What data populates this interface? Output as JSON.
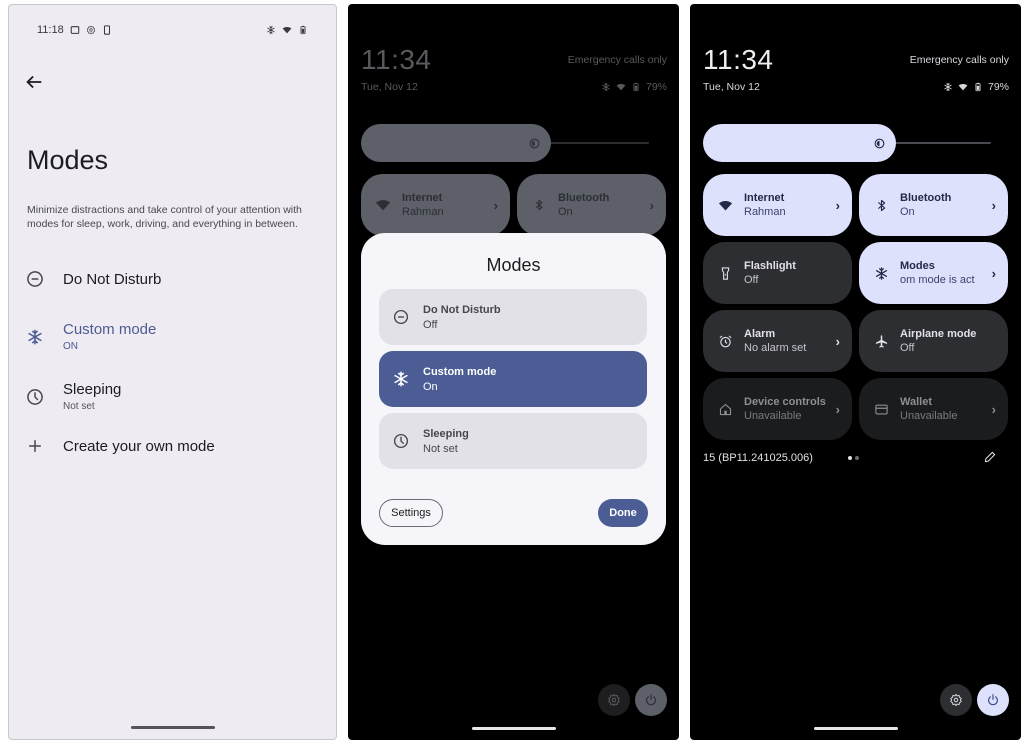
{
  "settings_screen": {
    "status_bar": {
      "time": "11:18",
      "left_icons": [
        "screen-icon",
        "settings-status-icon",
        "phone-status-icon"
      ],
      "right_icons": [
        "modes-status-icon",
        "wifi-icon",
        "battery-icon"
      ]
    },
    "back_icon": "arrow-left-icon",
    "title": "Modes",
    "description": "Minimize distractions and take control of your attention with modes for sleep, work, driving, and everything in between.",
    "modes": [
      {
        "icon": "do-not-disturb-icon",
        "name": "Do Not Disturb",
        "status": ""
      },
      {
        "icon": "snowflake-icon",
        "name": "Custom mode",
        "status": "ON",
        "active": true
      },
      {
        "icon": "clock-icon",
        "name": "Sleeping",
        "status": "Not set"
      },
      {
        "icon": "plus-icon",
        "name": "Create your own mode",
        "status": ""
      }
    ],
    "accent_color": "#4c5b91"
  },
  "shade_dialog": {
    "time": "11:34",
    "date": "Tue, Nov 12",
    "carrier": "Emergency calls only",
    "battery": "79%",
    "tiles": [
      {
        "icon": "wifi-icon",
        "name": "Internet",
        "status": "Rahman"
      },
      {
        "icon": "bluetooth-icon",
        "name": "Bluetooth",
        "status": "On"
      }
    ],
    "dialog": {
      "title": "Modes",
      "items": [
        {
          "icon": "do-not-disturb-icon",
          "name": "Do Not Disturb",
          "status": "Off",
          "active": false
        },
        {
          "icon": "snowflake-icon",
          "name": "Custom mode",
          "status": "On",
          "active": true
        },
        {
          "icon": "clock-icon",
          "name": "Sleeping",
          "status": "Not set",
          "active": false
        }
      ],
      "settings_label": "Settings",
      "done_label": "Done",
      "accent_color": "#4b5d94"
    }
  },
  "shade": {
    "time": "11:34",
    "date": "Tue, Nov 12",
    "carrier": "Emergency calls only",
    "battery": "79%",
    "brightness_fraction": 0.67,
    "tiles": [
      {
        "icon": "wifi-icon",
        "name": "Internet",
        "status": "Rahman",
        "state": "on",
        "chevron": true
      },
      {
        "icon": "bluetooth-icon",
        "name": "Bluetooth",
        "status": "On",
        "state": "on",
        "chevron": true
      },
      {
        "icon": "flashlight-icon",
        "name": "Flashlight",
        "status": "Off",
        "state": "off",
        "chevron": false
      },
      {
        "icon": "snowflake-icon",
        "name": "Modes",
        "status": "om mode is act",
        "state": "on",
        "chevron": true
      },
      {
        "icon": "alarm-icon",
        "name": "Alarm",
        "status": "No alarm set",
        "state": "off",
        "chevron": true
      },
      {
        "icon": "airplane-icon",
        "name": "Airplane mode",
        "status": "Off",
        "state": "off",
        "chevron": false
      },
      {
        "icon": "home-icon",
        "name": "Device controls",
        "status": "Unavailable",
        "state": "dim",
        "chevron": true
      },
      {
        "icon": "wallet-icon",
        "name": "Wallet",
        "status": "Unavailable",
        "state": "dim",
        "chevron": true
      }
    ],
    "build": "15 (BP11.241025.006)",
    "page_indicator": {
      "pages": 2,
      "current": 1
    },
    "tile_on_color": "#dde1fb"
  }
}
